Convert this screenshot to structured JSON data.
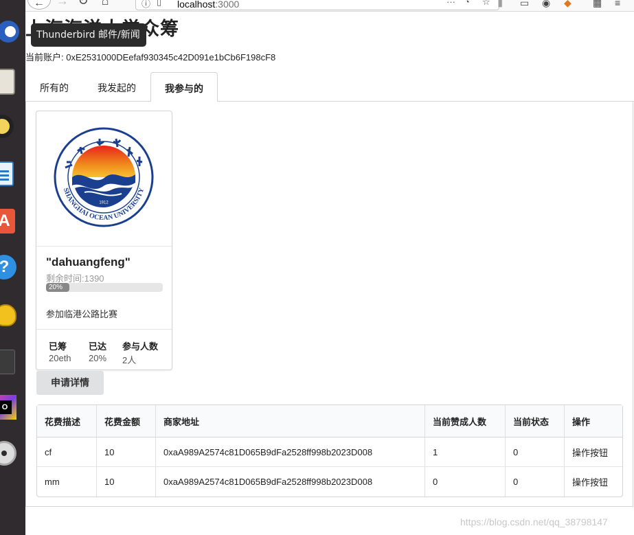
{
  "browser": {
    "url_host": "localhost",
    "url_port": ":3000"
  },
  "dock": {
    "apps": [
      {
        "icon": "firefox-icon"
      },
      {
        "icon": "files-icon"
      },
      {
        "icon": "rhythmbox-icon"
      },
      {
        "icon": "libreoffice-writer-icon"
      },
      {
        "icon": "software-center-icon"
      },
      {
        "icon": "help-icon"
      },
      {
        "icon": "trophy-icon"
      },
      {
        "icon": "terminal-icon"
      },
      {
        "icon": "ide-icon"
      },
      {
        "icon": "dvd-icon"
      }
    ]
  },
  "tooltip": "Thunderbird 邮件/新闻",
  "page": {
    "title": "上海海洋大学众筹",
    "account_label": "当前账户: ",
    "account_address": "0xE2531000DEefaf930345c42D091e1bCb6F198cF8"
  },
  "tabs": [
    {
      "label": "所有的",
      "active": false
    },
    {
      "label": "我发起的",
      "active": false
    },
    {
      "label": "我参与的",
      "active": true
    }
  ],
  "card": {
    "logo_alt": "上海海洋大学 SHANGHAI OCEAN UNIVERSITY 1912",
    "logo_arc_text": "SHANGHAI OCEAN UNIVERSITY",
    "logo_year": "1912",
    "logo_calligraphy": "上海海洋大学",
    "name": "\"dahuangfeng\"",
    "remaining": "剩余时间:1390",
    "progress_percent": 20,
    "progress_label": "20%",
    "description": "参加临港公路比赛",
    "stats": [
      {
        "label": "已筹",
        "value": "20eth"
      },
      {
        "label": "已达",
        "value": "20%"
      },
      {
        "label": "参与人数",
        "value": "2人"
      }
    ]
  },
  "detail_button": "申请详情",
  "table": {
    "headers": [
      "花费描述",
      "花费金额",
      "商家地址",
      "当前赞成人数",
      "当前状态",
      "操作"
    ],
    "rows": [
      [
        "cf",
        "10",
        "0xaA989A2574c81D065B9dFa2528ff998b2023D008",
        "1",
        "0",
        "操作按钮"
      ],
      [
        "mm",
        "10",
        "0xaA989A2574c81D065B9dFa2528ff998b2023D008",
        "0",
        "0",
        "操作按钮"
      ]
    ]
  },
  "watermark": "https://blog.csdn.net/qq_38798147",
  "colors": {
    "dock_bg": "#2f2b2e",
    "logo_blue": "#1b3f8f",
    "sun_orange": "#f08a1c",
    "button_gray": "#e0e1e2",
    "progress_gray": "#888888"
  }
}
